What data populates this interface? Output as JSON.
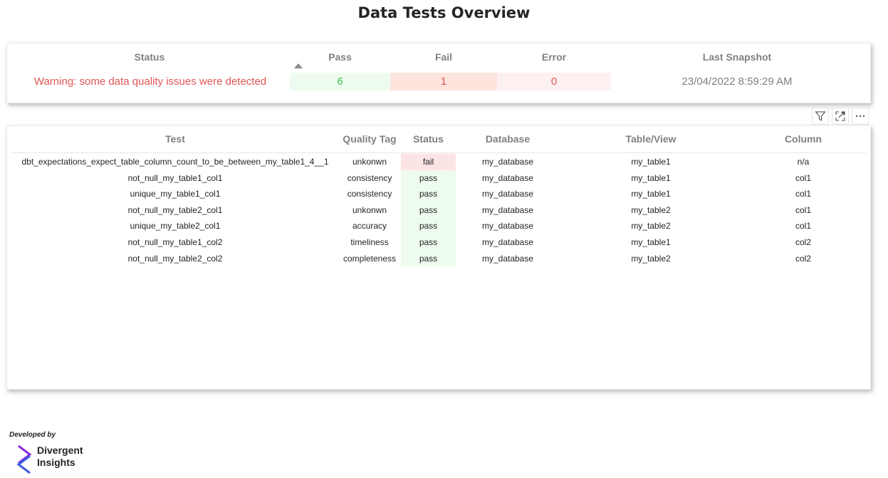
{
  "title": "Data Tests Overview",
  "summary": {
    "headers": {
      "status": "Status",
      "pass": "Pass",
      "fail": "Fail",
      "error": "Error",
      "last_snapshot": "Last Snapshot"
    },
    "status_text": "Warning: some data quality issues were detected",
    "pass": "6",
    "fail": "1",
    "error": "0",
    "last_snapshot": "23/04/2022 8:59:29 AM"
  },
  "visual_header_icons": [
    "filter-icon",
    "focus-mode-icon",
    "more-options-icon"
  ],
  "tests_table": {
    "columns": [
      "Test",
      "Quality Tag",
      "Status",
      "Database",
      "Table/View",
      "Column"
    ],
    "rows": [
      {
        "test": "dbt_expectations_expect_table_column_count_to_be_between_my_table1_4__1",
        "tag": "unkonwn",
        "status": "fail",
        "database": "my_database",
        "table": "my_table1",
        "column": "n/a"
      },
      {
        "test": "not_null_my_table1_col1",
        "tag": "consistency",
        "status": "pass",
        "database": "my_database",
        "table": "my_table1",
        "column": "col1"
      },
      {
        "test": "unique_my_table1_col1",
        "tag": "consistency",
        "status": "pass",
        "database": "my_database",
        "table": "my_table1",
        "column": "col1"
      },
      {
        "test": "not_null_my_table2_col1",
        "tag": "unkonwn",
        "status": "pass",
        "database": "my_database",
        "table": "my_table2",
        "column": "col1"
      },
      {
        "test": "unique_my_table2_col1",
        "tag": "accuracy",
        "status": "pass",
        "database": "my_database",
        "table": "my_table2",
        "column": "col1"
      },
      {
        "test": "not_null_my_table1_col2",
        "tag": "timeliness",
        "status": "pass",
        "database": "my_database",
        "table": "my_table1",
        "column": "col2"
      },
      {
        "test": "not_null_my_table2_col2",
        "tag": "completeness",
        "status": "pass",
        "database": "my_database",
        "table": "my_table2",
        "column": "col2"
      }
    ]
  },
  "footer": {
    "developed_by": "Developed by",
    "brand_line1": "Divergent",
    "brand_line2": "Insights"
  },
  "colors": {
    "pass_bg": "#eefcef",
    "pass_text": "#3cc04a",
    "fail_bg": "#fde4dc",
    "error_bg": "#fdf0f0",
    "warning_text": "#e05555",
    "logo_purple": "#8a2be2",
    "logo_blue": "#3b5bdb"
  }
}
